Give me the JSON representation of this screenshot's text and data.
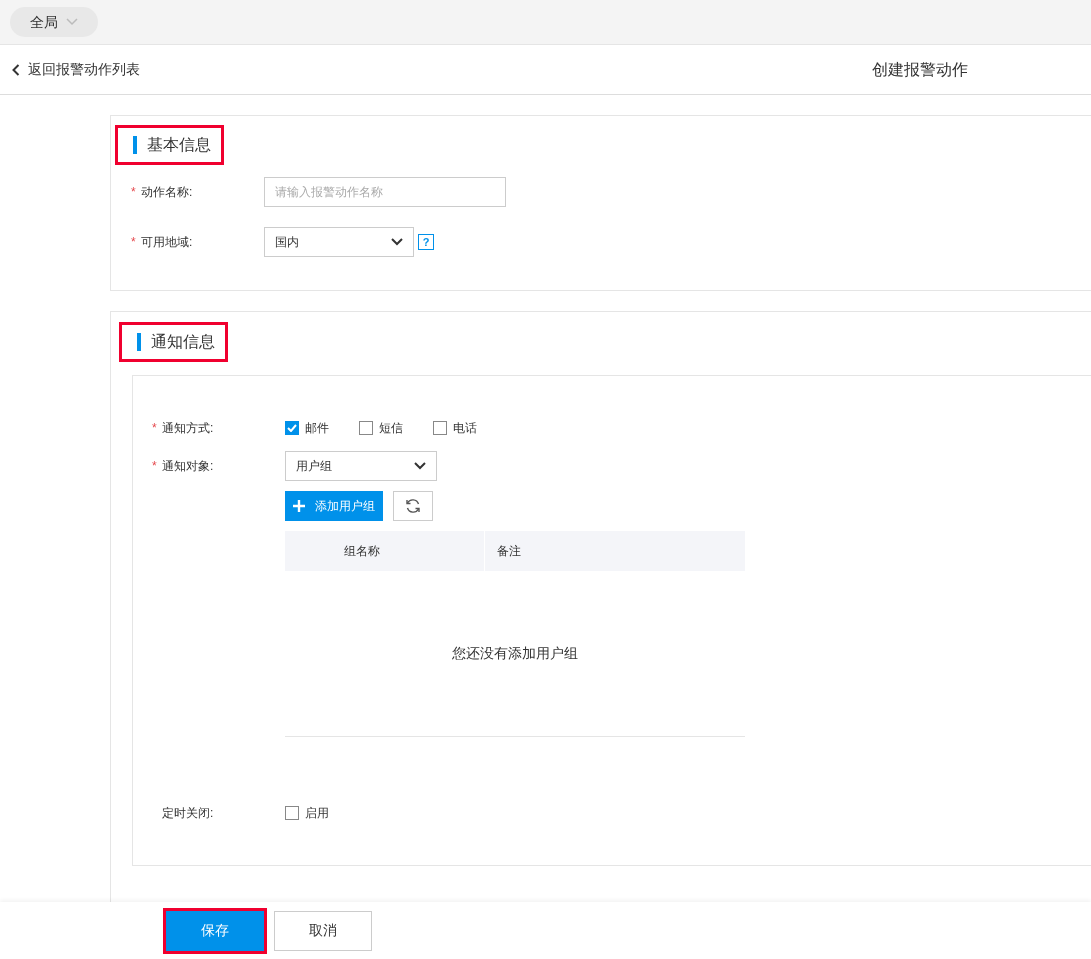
{
  "scope_selector": {
    "label": "全局"
  },
  "header": {
    "back_link": "返回报警动作列表",
    "title": "创建报警动作"
  },
  "basic_section": {
    "heading": "基本信息",
    "highlighted": true,
    "fields": [
      {
        "kind": "text",
        "required_mark": "*",
        "label": "动作名称:",
        "placeholder": "请输入报警动作名称"
      },
      {
        "kind": "select",
        "required_mark": "*",
        "label": "可用地域:",
        "value": "国内",
        "help": "?"
      }
    ]
  },
  "notify_section": {
    "heading": "通知信息",
    "highlighted": true,
    "method": {
      "required_mark": "*",
      "label": "通知方式:",
      "options": [
        {
          "label": "邮件",
          "checked": true
        },
        {
          "label": "短信",
          "checked": false
        },
        {
          "label": "电话",
          "checked": false
        }
      ]
    },
    "target": {
      "required_mark": "*",
      "label": "通知对象:",
      "value": "用户组",
      "add_button": "添加用户组"
    },
    "table": {
      "columns": [
        "组名称",
        "备注"
      ],
      "empty_text": "您还没有添加用户组"
    },
    "timer": {
      "label": "定时关闭:",
      "option": {
        "label": "启用",
        "checked": false
      }
    }
  },
  "footer": {
    "buttons": [
      {
        "kind": "primary",
        "label": "保存",
        "highlighted": true
      },
      {
        "kind": "default",
        "label": "取消",
        "highlighted": false
      }
    ]
  }
}
